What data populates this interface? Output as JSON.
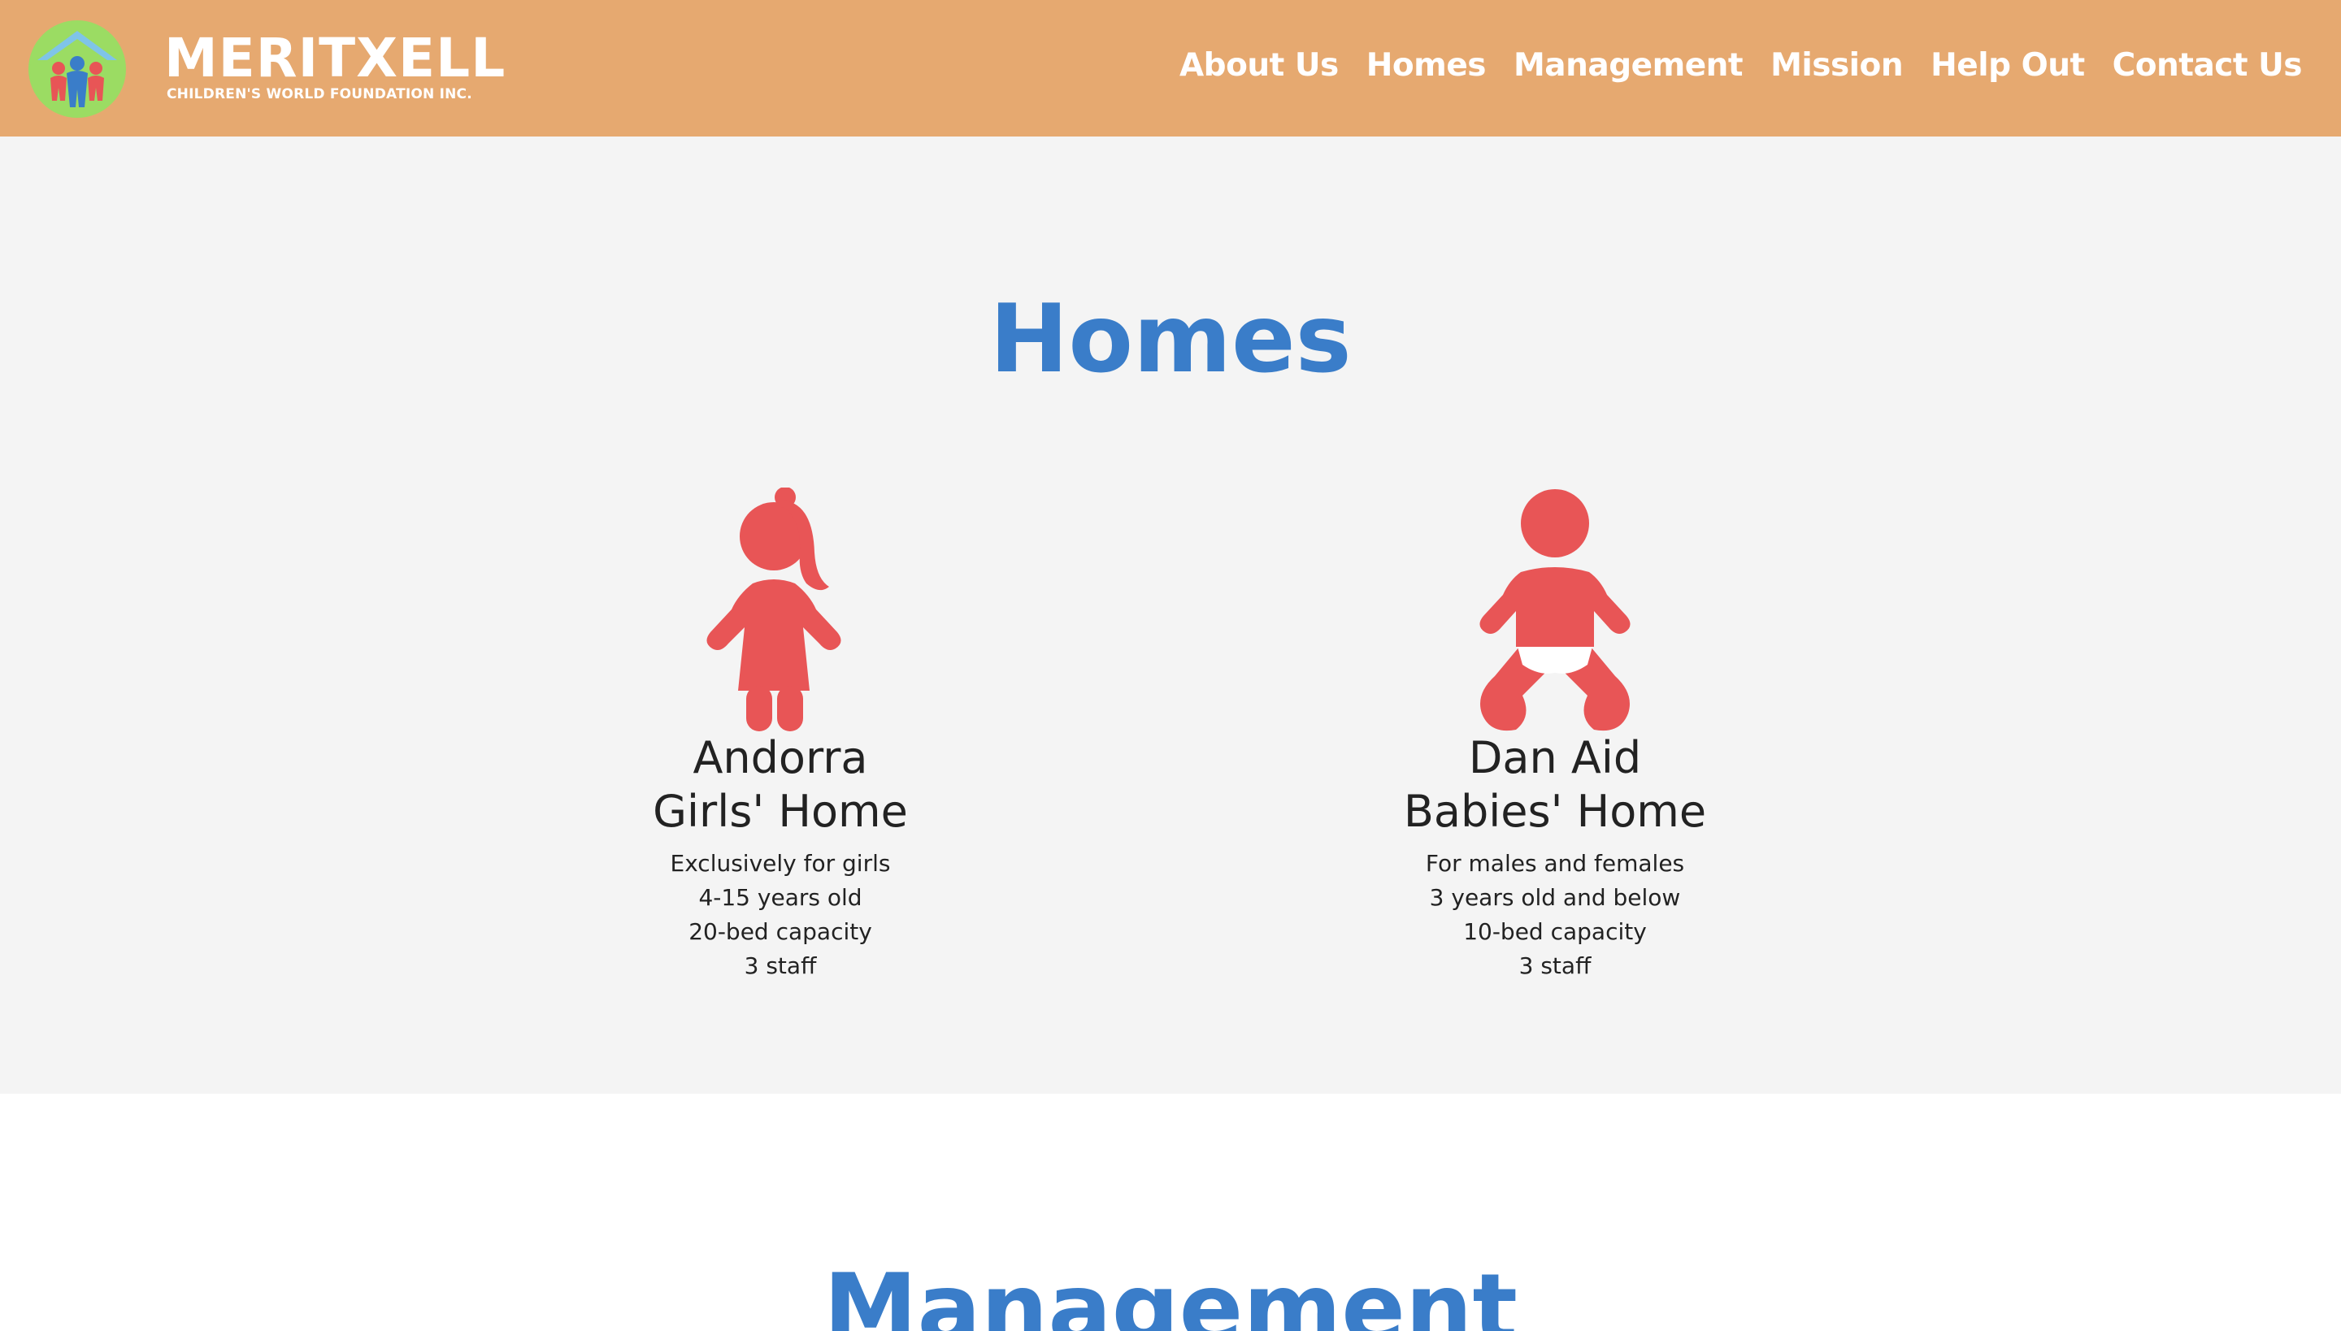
{
  "header": {
    "brand_name": "MERITXELL",
    "brand_subtitle": "CHILDREN'S WORLD FOUNDATION INC.",
    "logo_icon": "family-house-logo",
    "nav": [
      {
        "label": "About Us"
      },
      {
        "label": "Homes"
      },
      {
        "label": "Management"
      },
      {
        "label": "Mission"
      },
      {
        "label": "Help Out"
      },
      {
        "label": "Contact Us"
      }
    ]
  },
  "homes": {
    "title": "Homes",
    "cards": [
      {
        "icon": "girl-icon",
        "title_line1": "Andorra",
        "title_line2": "Girls' Home",
        "lines": [
          "Exclusively for girls",
          "4-15 years old",
          "20-bed capacity",
          "3 staff"
        ]
      },
      {
        "icon": "baby-icon",
        "title_line1": "Dan Aid",
        "title_line2": "Babies' Home",
        "lines": [
          "For males and females",
          "3 years old and below",
          "10-bed capacity",
          "3 staff"
        ]
      }
    ]
  },
  "management": {
    "title": "Management"
  },
  "colors": {
    "header_bg": "#e6a970",
    "section_bg": "#f4f4f4",
    "title_blue": "#3a7dc9",
    "icon_red": "#e85556"
  }
}
